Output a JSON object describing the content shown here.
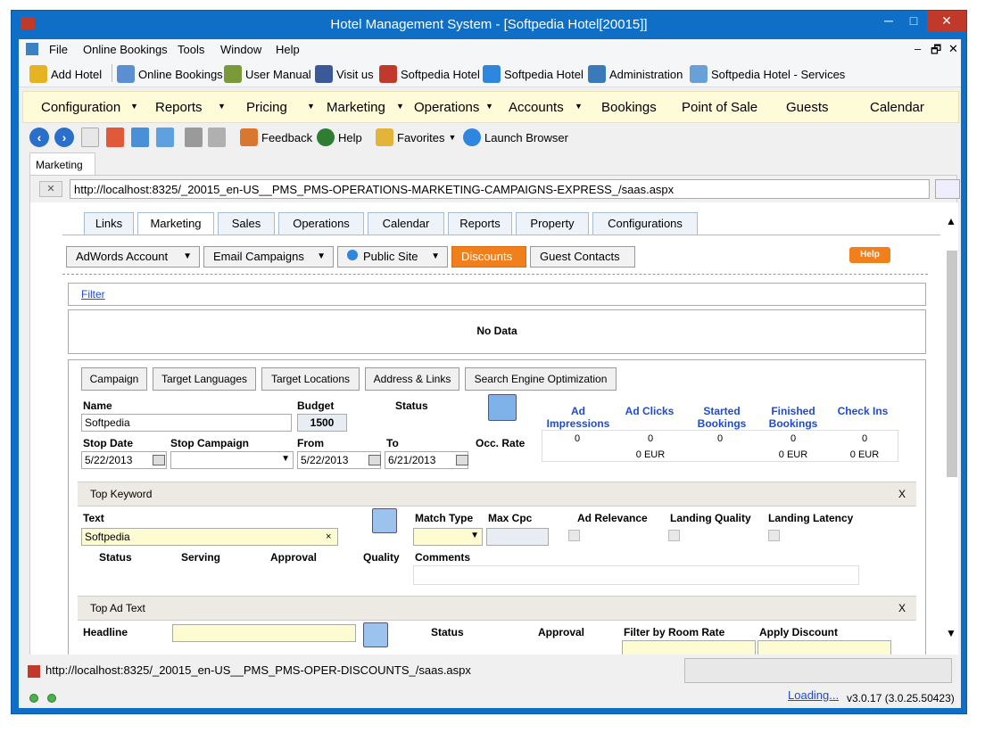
{
  "window": {
    "title": "Hotel Management System - [Softpedia Hotel[20015]]",
    "min": "─",
    "max": "□",
    "close": "✕"
  },
  "menu": [
    "File",
    "Online Bookings",
    "Tools",
    "Window",
    "Help"
  ],
  "mdi_controls": [
    "–",
    "🗗",
    "✕"
  ],
  "toolbar1": [
    "Add Hotel",
    "Online Bookings",
    "User Manual",
    "Visit us",
    "Softpedia Hotel",
    "Softpedia Hotel",
    "Administration",
    "Softpedia Hotel - Services"
  ],
  "mainmenu": [
    "Configuration",
    "Reports",
    "Pricing",
    "Marketing",
    "Operations",
    "Accounts",
    "Bookings",
    "Point of Sale",
    "Guests",
    "Calendar"
  ],
  "toolbar2": {
    "feedback": "Feedback",
    "help": "Help",
    "favorites": "Favorites",
    "launch": "Launch Browser"
  },
  "doc_tab": "Marketing",
  "url": "http://localhost:8325/_20015_en-US__PMS_PMS-OPERATIONS-MARKETING-CAMPAIGNS-EXPRESS_/saas.aspx",
  "url_clear": "✕",
  "page_tabs": [
    "Links",
    "Marketing",
    "Sales",
    "Operations",
    "Calendar",
    "Reports",
    "Property",
    "Configurations"
  ],
  "buttons": {
    "adwords": "AdWords Account",
    "email": "Email Campaigns",
    "public": "Public Site",
    "discounts": "Discounts",
    "guest": "Guest Contacts",
    "help": "Help"
  },
  "filter": "Filter",
  "no_data": "No Data",
  "sub_tabs": [
    "Campaign",
    "Target Languages",
    "Target Locations",
    "Address & Links",
    "Search Engine Optimization"
  ],
  "campaign": {
    "name_lbl": "Name",
    "name": "Softpedia",
    "budget_lbl": "Budget",
    "budget": "1500",
    "status_lbl": "Status",
    "stop_date_lbl": "Stop Date",
    "stop_date": "5/22/2013",
    "stop_campaign_lbl": "Stop Campaign",
    "from_lbl": "From",
    "from": "5/22/2013",
    "to_lbl": "To",
    "to": "6/21/2013",
    "occ_lbl": "Occ. Rate"
  },
  "stats": {
    "headers": [
      "Ad Impressions",
      "Ad Clicks",
      "Started Bookings",
      "Finished Bookings",
      "Check Ins"
    ],
    "values": [
      "0",
      "0",
      "0",
      "0",
      "0"
    ],
    "eur": [
      "0 EUR",
      "0 EUR",
      "0 EUR"
    ]
  },
  "keyword": {
    "title": "Top Keyword",
    "close": "X",
    "text_lbl": "Text",
    "text": "Softpedia",
    "match_lbl": "Match Type",
    "maxcpc_lbl": "Max Cpc",
    "adrel_lbl": "Ad Relevance",
    "landq_lbl": "Landing Quality",
    "landl_lbl": "Landing Latency",
    "status_lbl": "Status",
    "serving_lbl": "Serving",
    "approval_lbl": "Approval",
    "quality_lbl": "Quality",
    "comments_lbl": "Comments"
  },
  "adtext": {
    "title": "Top Ad Text",
    "close": "X",
    "headline_lbl": "Headline",
    "status_lbl": "Status",
    "approval_lbl": "Approval",
    "filter_lbl": "Filter by Room Rate",
    "discount_lbl": "Apply Discount"
  },
  "status": {
    "url": "http://localhost:8325/_20015_en-US__PMS_PMS-OPER-DISCOUNTS_/saas.aspx",
    "loading": "Loading...",
    "version": "v3.0.17 (3.0.25.50423)"
  }
}
